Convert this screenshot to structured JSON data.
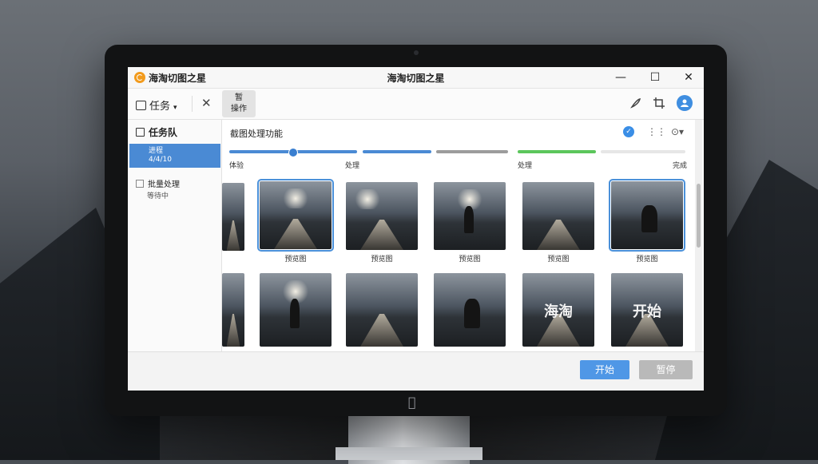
{
  "window": {
    "app_name": "海淘切图之星",
    "title": "海淘切图之星",
    "minimize": "—",
    "maximize": "☐",
    "close": "✕"
  },
  "toolbar": {
    "task_label": "任务",
    "task_chevron": "▾",
    "close_glyph": "✕",
    "pause_line1": "暂",
    "pause_line2": "操作",
    "right_icons": [
      "brush-icon",
      "crop-icon",
      "account-icon"
    ]
  },
  "sidebar": {
    "title": "任务队",
    "active_item": {
      "line1": "进程",
      "line2": "4/4/10"
    },
    "item2": {
      "label": "批量处理",
      "sub": "等待中"
    }
  },
  "main": {
    "title": "截图处理功能",
    "progress_labels": [
      "体验",
      "处理",
      "处理",
      "完成"
    ],
    "row1_captions": [
      "",
      "预览图",
      "预览图",
      "预览图",
      "预览图",
      "预览图"
    ],
    "row1_partial_caption": "",
    "overlay_texts": [
      "海淘",
      "开始"
    ]
  },
  "progress": {
    "segments": [
      {
        "color": "#4a8ad4",
        "fill": 1.0
      },
      {
        "color": "#4a8ad4",
        "fill": 1.0
      },
      {
        "color": "#9c9c9c",
        "fill": 1.0
      },
      {
        "color": "#5cc65c",
        "fill": 1.0
      },
      {
        "color": "#e6e6e6",
        "fill": 1.0
      }
    ],
    "knob_fraction": 0.5
  },
  "buttons": {
    "start": "开始",
    "pause": "暂停"
  },
  "colors": {
    "accent": "#4a8ad4",
    "success": "#5cc65c",
    "selection": "#4a90d9"
  }
}
